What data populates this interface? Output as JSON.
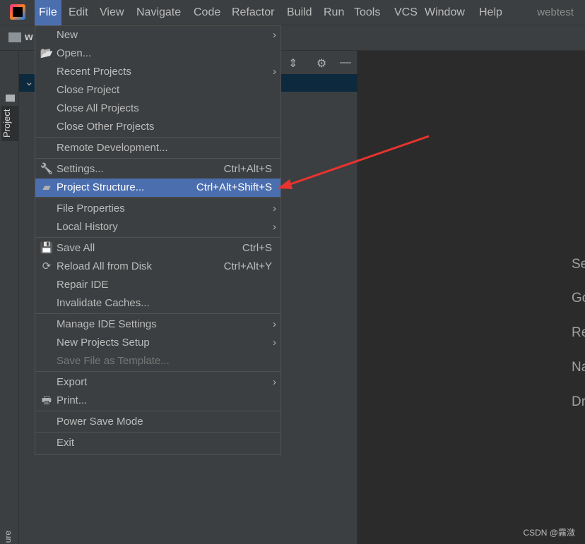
{
  "menubar": {
    "items": [
      "File",
      "Edit",
      "View",
      "Navigate",
      "Code",
      "Refactor",
      "Build",
      "Run",
      "Tools",
      "VCS",
      "Window",
      "Help"
    ],
    "title": "webtest",
    "active": "File"
  },
  "navbar": {
    "project_initial": "w"
  },
  "sidebar": {
    "tab": "Project",
    "bottom_tab": "ure"
  },
  "file_menu": {
    "items": [
      {
        "label": "New",
        "submenu": true
      },
      {
        "label": "Open...",
        "icon": "folder-open-icon"
      },
      {
        "label": "Recent Projects",
        "submenu": true
      },
      {
        "label": "Close Project"
      },
      {
        "label": "Close All Projects"
      },
      {
        "label": "Close Other Projects"
      },
      {
        "label": "Remote Development..."
      },
      {
        "label": "Settings...",
        "shortcut": "Ctrl+Alt+S",
        "icon": "wrench-icon"
      },
      {
        "label": "Project Structure...",
        "shortcut": "Ctrl+Alt+Shift+S",
        "icon": "project-structure-icon",
        "highlighted": true
      },
      {
        "label": "File Properties",
        "submenu": true
      },
      {
        "label": "Local History",
        "submenu": true
      },
      {
        "label": "Save All",
        "shortcut": "Ctrl+S",
        "icon": "save-icon"
      },
      {
        "label": "Reload All from Disk",
        "shortcut": "Ctrl+Alt+Y",
        "icon": "reload-icon"
      },
      {
        "label": "Repair IDE"
      },
      {
        "label": "Invalidate Caches..."
      },
      {
        "label": "Manage IDE Settings",
        "submenu": true
      },
      {
        "label": "New Projects Setup",
        "submenu": true
      },
      {
        "label": "Save File as Template...",
        "disabled": true
      },
      {
        "label": "Export",
        "submenu": true
      },
      {
        "label": "Print...",
        "icon": "print-icon"
      },
      {
        "label": "Power Save Mode"
      },
      {
        "label": "Exit"
      }
    ]
  },
  "editor": {
    "hints": [
      "Se",
      "Go",
      "Re",
      "Na",
      "Dr"
    ]
  },
  "watermark": "CSDN @霧潋",
  "colors": {
    "accent": "#4b6eaf",
    "arrow": "#e8332e"
  }
}
